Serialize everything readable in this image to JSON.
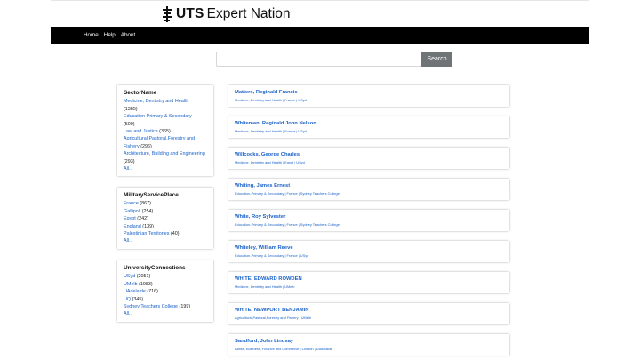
{
  "header": {
    "logo_bold": "UTS",
    "logo_rest": "Expert Nation"
  },
  "nav": {
    "items": [
      "Home",
      "Help",
      "About"
    ]
  },
  "search": {
    "value": "",
    "placeholder": "",
    "button_label": "Search"
  },
  "facets": [
    {
      "title": "SectorName",
      "items": [
        {
          "label": "Medicine, Dentistry and Health",
          "count": "(1385)"
        },
        {
          "label": "Education-Primary & Secondary",
          "count": "(500)"
        },
        {
          "label": "Law and Justice",
          "count": "(365)"
        },
        {
          "label": "Agricultural,Pastoral,Forestry and Fishery",
          "count": "(296)"
        },
        {
          "label": "Architecture, Building and Engineering",
          "count": "(293)"
        }
      ],
      "all_label": "All..."
    },
    {
      "title": "MilitaryServicePlace",
      "items": [
        {
          "label": "France",
          "count": "(867)"
        },
        {
          "label": "Gallipoli",
          "count": "(254)"
        },
        {
          "label": "Egypt",
          "count": "(242)"
        },
        {
          "label": "England",
          "count": "(139)"
        },
        {
          "label": "Palestinian Territories",
          "count": "(40)"
        }
      ],
      "all_label": "All..."
    },
    {
      "title": "UniversityConnections",
      "items": [
        {
          "label": "USyd",
          "count": "(2051)"
        },
        {
          "label": "UMelb",
          "count": "(1983)"
        },
        {
          "label": "UAdelaide",
          "count": "(716)"
        },
        {
          "label": "UQ",
          "count": "(345)"
        },
        {
          "label": "Sydney Teachers College",
          "count": "(199)"
        }
      ],
      "all_label": "All..."
    }
  ],
  "results": [
    {
      "name": "Matters, Reginald Francis",
      "meta": "Medicine, Dentistry and Health | France | USyd"
    },
    {
      "name": "Whiteman, Reginald John Nelson",
      "meta": "Medicine, Dentistry and Health | France | USyd"
    },
    {
      "name": "Willcocks, George Charles",
      "meta": "Medicine, Dentistry and Health | Egypt | USyd"
    },
    {
      "name": "Whiting, James Ernest",
      "meta": "Education-Primary & Secondary | France | Sydney Teachers College"
    },
    {
      "name": "White, Roy Sylvester",
      "meta": "Education-Primary & Secondary | France | Sydney Teachers College"
    },
    {
      "name": "Whiteley, William Reeve",
      "meta": "Education-Primary & Secondary | France | USyd"
    },
    {
      "name": "WHITE, EDWARD ROWDEN",
      "meta": "Medicine, Dentistry and Health | UMelb"
    },
    {
      "name": "WHITE, NEWPORT BENJAMIN",
      "meta": "Agricultural,Pastoral,Forestry and Fishery | UMelb"
    },
    {
      "name": "Sandford, John Lindsay",
      "meta": "Banks, Business, Finance and Commerce | London | UAdelaide"
    }
  ]
}
